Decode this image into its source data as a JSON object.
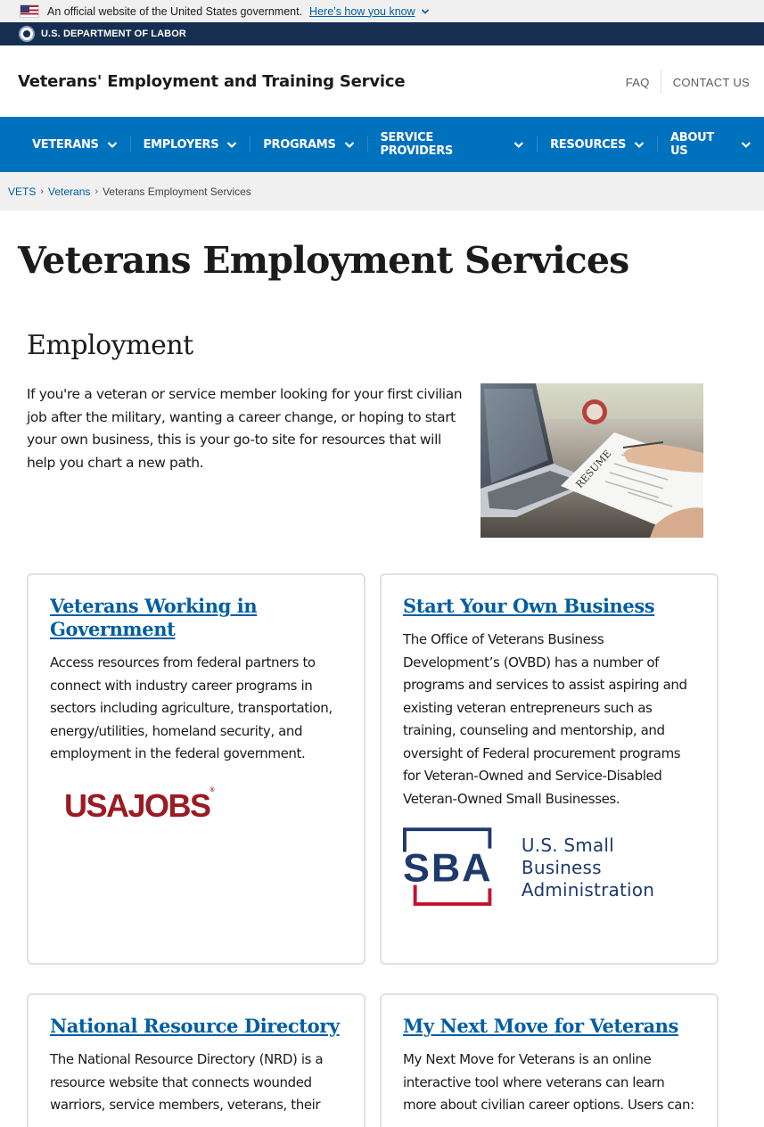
{
  "gov_banner": {
    "text": "An official website of the United States government.",
    "link": "Here’s how you know"
  },
  "agency_bar": {
    "name": "U.S. DEPARTMENT OF LABOR"
  },
  "header": {
    "site_title": "Veterans' Employment and Training Service",
    "utility_links": [
      "FAQ",
      "CONTACT US"
    ]
  },
  "nav": {
    "items": [
      "VETERANS",
      "EMPLOYERS",
      "PROGRAMS",
      "SERVICE PROVIDERS",
      "RESOURCES",
      "ABOUT US"
    ]
  },
  "breadcrumb": {
    "items": [
      "VETS",
      "Veterans"
    ],
    "current": "Veterans Employment Services"
  },
  "page": {
    "title": "Veterans Employment Services",
    "section_heading": "Employment",
    "intro": "If you're a veteran or service member looking for your first civilian job after the military, wanting a career change, or hoping to start your own business, this is your go-to site for resources that will help you chart a new path.",
    "photo_label": "RESUME"
  },
  "cards": [
    {
      "title": "Veterans Working in Government",
      "body": "Access resources from federal partners to connect with industry career programs in sectors including agriculture, transportation, energy/utilities, homeland security, and employment in the federal government.",
      "logo_text": "USAJOBS"
    },
    {
      "title": "Start Your Own Business",
      "body": "The Office of Veterans Business Development’s (OVBD) has a number of programs and services to assist aspiring and existing veteran entrepreneurs such as training, counseling and mentorship, and oversight of Federal procurement programs for Veteran-Owned and Service-Disabled Veteran-Owned Small Businesses.",
      "logo_text": "SBA",
      "logo_line1": "U.S. Small Business",
      "logo_line2": "Administration"
    },
    {
      "title": "National Resource Directory",
      "body": "The National Resource Directory (NRD) is a resource website that connects wounded warriors, service members, veterans, their"
    },
    {
      "title": "My Next Move for Veterans",
      "body": "My Next Move for Veterans is an online interactive tool where veterans can learn more about civilian career options. Users can:"
    }
  ],
  "colors": {
    "nav_blue": "#0071bc",
    "agency_navy": "#162e51",
    "link_blue": "#005ea2",
    "usajobs_red": "#9b1b24",
    "sba_navy": "#1e3a6d",
    "sba_red": "#c41230"
  }
}
